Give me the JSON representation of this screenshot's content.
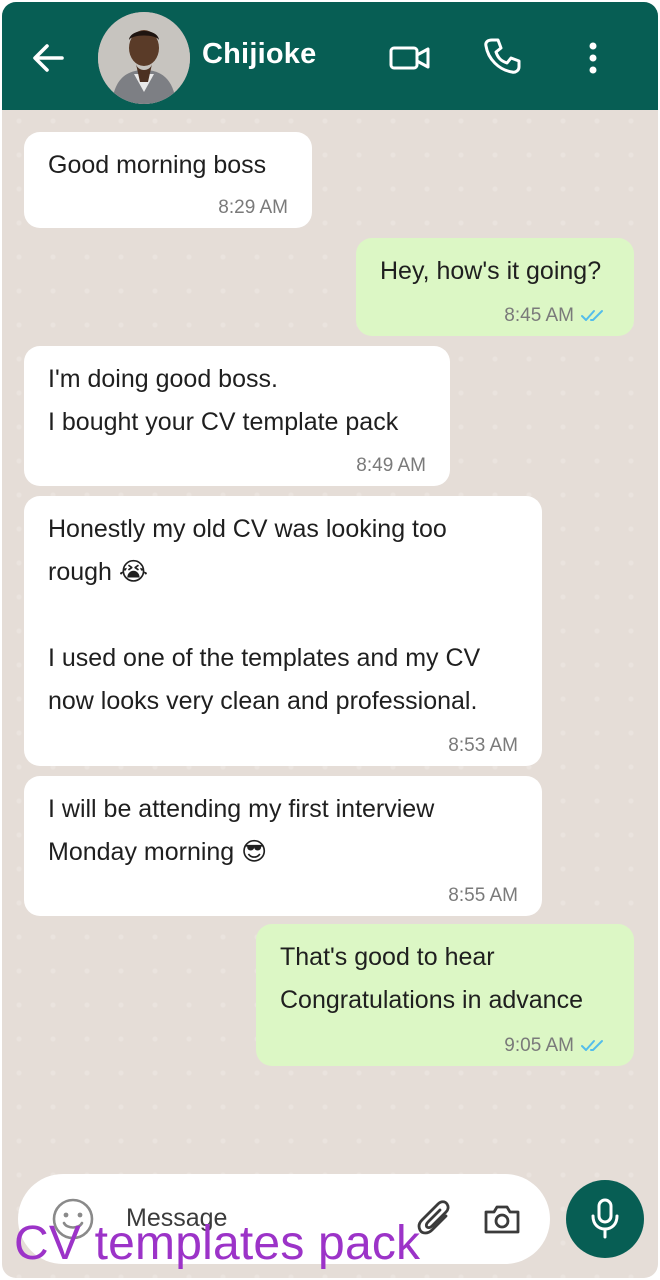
{
  "header": {
    "contact_name": "Chijioke",
    "icons": [
      "back-arrow-icon",
      "video-call-icon",
      "phone-call-icon",
      "more-options-icon"
    ]
  },
  "messages": [
    {
      "direction": "incoming",
      "lines": [
        "Good morning boss"
      ],
      "time": "8:29 AM"
    },
    {
      "direction": "outgoing",
      "lines": [
        "Hey, how's it going?"
      ],
      "time": "8:45 AM",
      "status": "read"
    },
    {
      "direction": "incoming",
      "lines": [
        "I'm doing good boss.",
        "I bought your CV template pack"
      ],
      "time": "8:49 AM"
    },
    {
      "direction": "incoming",
      "lines": [
        "Honestly my old CV was looking too",
        "rough 😭",
        "",
        "I used one of the templates and my CV",
        "now looks very clean and professional."
      ],
      "time": "8:53 AM"
    },
    {
      "direction": "incoming",
      "lines": [
        "I will be attending my first interview",
        "Monday morning 😎"
      ],
      "time": "8:55 AM"
    },
    {
      "direction": "outgoing",
      "lines": [
        "That's good to hear",
        "Congratulations in advance"
      ],
      "time": "9:05 AM",
      "status": "read"
    }
  ],
  "input": {
    "placeholder": "Message",
    "icons": [
      "emoji-icon",
      "attach-icon",
      "camera-icon",
      "mic-icon"
    ]
  },
  "watermark": "CV templates pack",
  "colors": {
    "header": "#075e54",
    "chat_background": "#e5ddd7",
    "incoming_bubble": "#ffffff",
    "outgoing_bubble": "#dcf7c5",
    "read_ticks": "#53bdeb",
    "watermark": "#9c33c8"
  }
}
